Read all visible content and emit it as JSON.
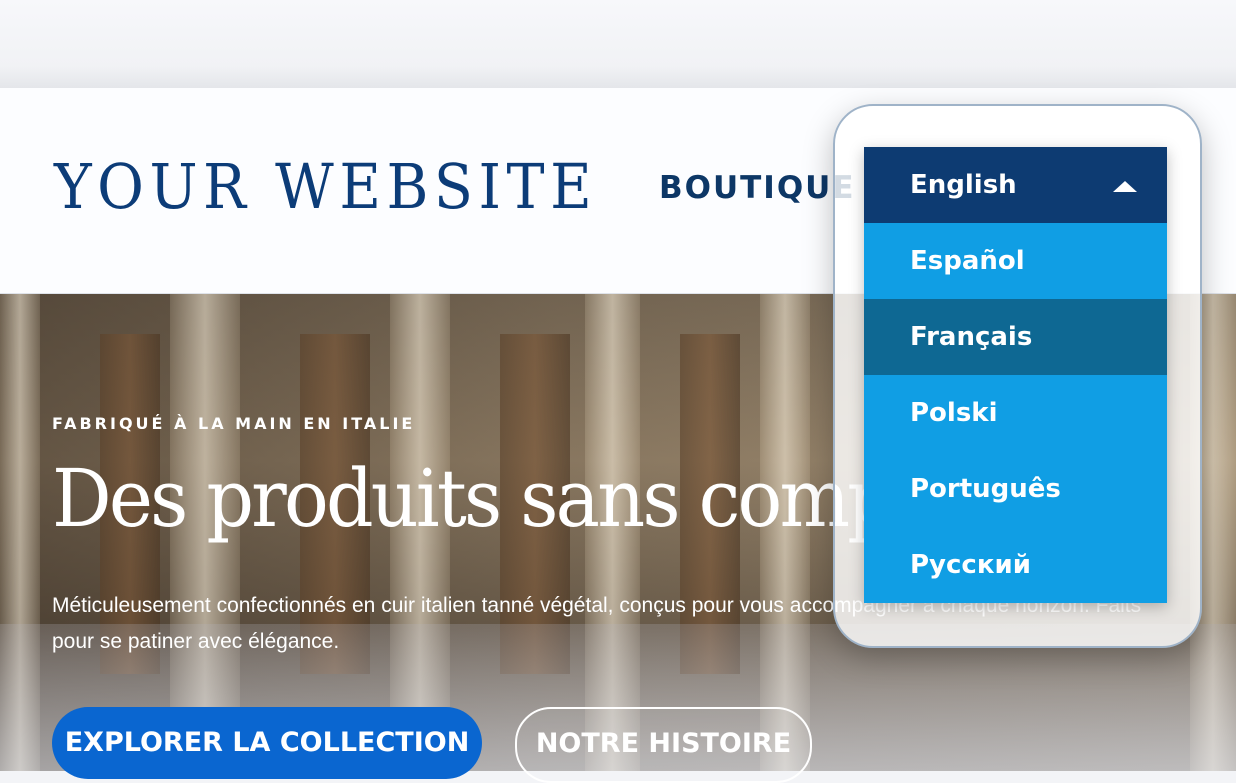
{
  "header": {
    "logo": "YOUR WEBSITE",
    "nav": [
      {
        "label": "BOUTIQUE"
      }
    ]
  },
  "language_dropdown": {
    "selected": "English",
    "options": [
      "English",
      "Español",
      "Français",
      "Polski",
      "Português",
      "Русский"
    ],
    "hovered": "Français"
  },
  "hero": {
    "kicker": "FABRIQUÉ À LA MAIN EN ITALIE",
    "headline": "Des produits sans compromis",
    "description": "Méticuleusement confectionnés en cuir italien tanné végétal, conçus pour vous accompagner à chaque horizon. Faits pour se patiner avec élégance.",
    "primary_button": "EXPLORER LA COLLECTION",
    "secondary_button": "NOTRE HISTOIRE"
  },
  "colors": {
    "brand_navy": "#0c3c78",
    "dropdown_item": "#109ee4",
    "dropdown_selected": "#0d3b72",
    "dropdown_hover": "#0e6893",
    "primary_button": "#0a66d0"
  },
  "icons": {
    "dropdown_caret": "caret-up-icon"
  }
}
